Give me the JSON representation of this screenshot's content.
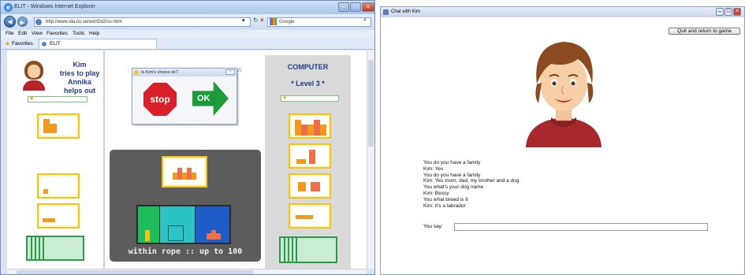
{
  "ie": {
    "title": "ELIT - Windows Internet Explorer",
    "address": "http://www.ida.liu.se/ext/t2d2/ss.html",
    "search_placeholder": "Google",
    "menu": [
      "File",
      "Edit",
      "View",
      "Favorites",
      "Tools",
      "Help"
    ],
    "favorites_label": "Favorites",
    "tab_label": "ELIT"
  },
  "game": {
    "player_line1": "Kim",
    "player_line2": "tries to play",
    "helper_line1": "Annika",
    "helper_line2": "helps out",
    "dialog_title": "Is Kim's choice ok?",
    "stop_label": "stop",
    "ok_label": "OK",
    "computer_label": "COMPUTER",
    "level_label": "* Level 3 *",
    "board_caption": "within rope :: up to 100"
  },
  "chat": {
    "window_title": "Chat with Kim",
    "quit_button": "Quit and return to game",
    "log": [
      "You do you have a family",
      "Kim: Yes",
      "You do you have a family",
      "Kim: Yes mom, dad, my brother and a dog",
      "You what's your dog name",
      "Kim: Bessy",
      "You what breed is it",
      "Kim: it's a labrador"
    ],
    "say_label": "You say:",
    "say_value": ""
  },
  "colors": {
    "card_border": "#f0c419",
    "orange_block": "#f39a1e",
    "red_block": "#ee6d4b",
    "green_stack": "#2d9b4b",
    "title_blue": "#1f3c8a"
  }
}
